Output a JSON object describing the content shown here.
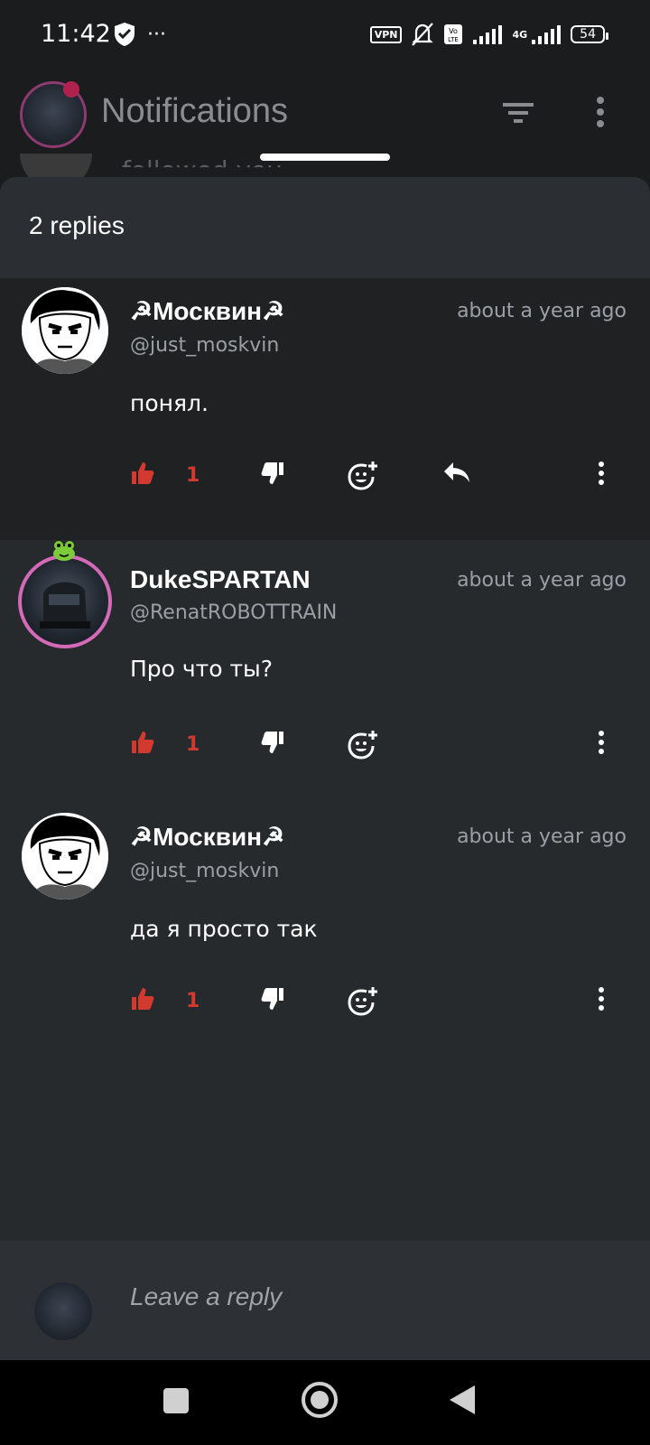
{
  "status": {
    "time": "11:42",
    "vpn": "VPN",
    "network": "4G",
    "battery": "54"
  },
  "appbar": {
    "title": "Notifications"
  },
  "behind": {
    "text": "followed you"
  },
  "sheet": {
    "title": "2 replies"
  },
  "comments": [
    {
      "author": "☭Москвин☭",
      "handle": "@just_moskvin",
      "time": "about a year ago",
      "text": "понял.",
      "likes": "1"
    },
    {
      "author": "DukeSPARTAN",
      "handle": "@RenatROBOTTRAIN",
      "time": "about a year ago",
      "text": "Про что ты?",
      "likes": "1"
    },
    {
      "author": "☭Москвин☭",
      "handle": "@just_moskvin",
      "time": "about a year ago",
      "text": "да я просто так",
      "likes": "1"
    }
  ],
  "reply": {
    "placeholder": "Leave a reply"
  },
  "colors": {
    "like": "#d23a2f",
    "background": "#272a2d"
  }
}
